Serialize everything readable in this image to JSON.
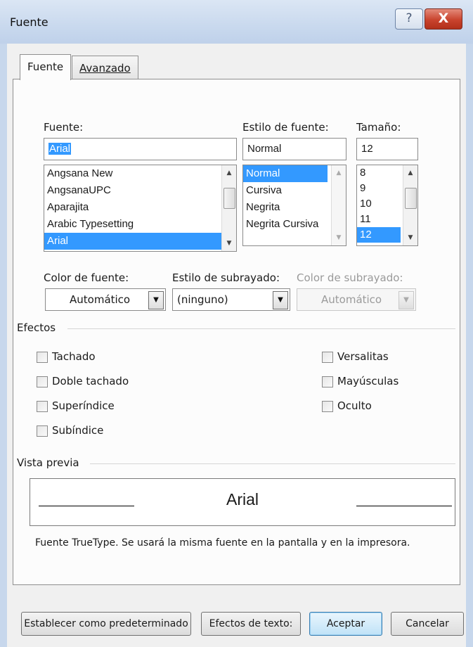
{
  "window": {
    "title": "Fuente",
    "help_label": "?",
    "close_label": "X"
  },
  "tabs": [
    {
      "label": "Fuente",
      "active": true
    },
    {
      "label": "Avanzado",
      "active": false
    }
  ],
  "font": {
    "label": "Fuente:",
    "value": "Arial",
    "list": [
      "Angsana New",
      "AngsanaUPC",
      "Aparajita",
      "Arabic Typesetting",
      "Arial"
    ],
    "selected": "Arial"
  },
  "style": {
    "label": "Estilo de fuente:",
    "value": "Normal",
    "list": [
      "Normal",
      "Cursiva",
      "Negrita",
      "Negrita Cursiva"
    ],
    "selected": "Normal"
  },
  "size": {
    "label": "Tamaño:",
    "value": "12",
    "list": [
      "8",
      "9",
      "10",
      "11",
      "12"
    ],
    "selected": "12"
  },
  "font_color": {
    "label": "Color de fuente:",
    "value": "Automático"
  },
  "underline_style": {
    "label": "Estilo de subrayado:",
    "value": "(ninguno)"
  },
  "underline_color": {
    "label": "Color de subrayado:",
    "value": "Automático",
    "disabled": true
  },
  "effects": {
    "title": "Efectos",
    "left": [
      {
        "label": "Tachado",
        "checked": false
      },
      {
        "label": "Doble tachado",
        "checked": false
      },
      {
        "label": "Superíndice",
        "checked": false
      },
      {
        "label": "Subíndice",
        "checked": false
      }
    ],
    "right": [
      {
        "label": "Versalitas",
        "checked": false
      },
      {
        "label": "Mayúsculas",
        "checked": false
      },
      {
        "label": "Oculto",
        "checked": false
      }
    ]
  },
  "preview": {
    "title": "Vista previa",
    "sample": "Arial",
    "note": "Fuente TrueType. Se usará la misma fuente en la pantalla y en la impresora."
  },
  "buttons": {
    "set_default": "Establecer como predeterminado",
    "text_effects": "Efectos de texto:",
    "ok": "Aceptar",
    "cancel": "Cancelar"
  },
  "colors": {
    "selection": "#3399ff",
    "close_button": "#c9432d"
  }
}
